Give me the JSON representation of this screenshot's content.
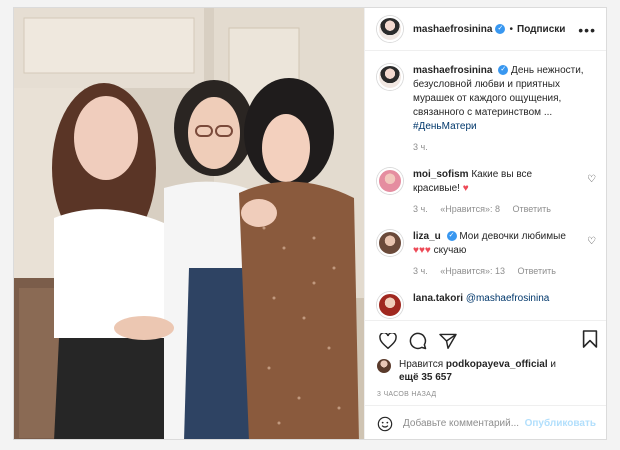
{
  "post": {
    "author": "mashaefrosinina",
    "follow_separator": "•",
    "follow_label": "Подписки",
    "more_icon": "more-horizontal-icon"
  },
  "caption": {
    "author": "mashaefrosinina",
    "text": "День нежности, безусловной любви и приятных мурашек от каждого ощущения, связанного с материнством ...",
    "hashtag": "#ДеньМатери",
    "time": "3 ч."
  },
  "comments": [
    {
      "author": "moi_sofism",
      "text": "Какие вы все красивые!",
      "emoji": "♥",
      "time": "3 ч.",
      "likes": "«Нравится»: 8",
      "reply": "Ответить"
    },
    {
      "author": "liza_u",
      "text": "Мои девочки любимые",
      "emoji": "♥♥♥",
      "text2": "скучаю",
      "time": "3 ч.",
      "likes": "«Нравится»: 13",
      "reply": "Ответить"
    },
    {
      "author": "lana.takori",
      "text": "@mashaefrosinina"
    }
  ],
  "likes": {
    "prefix": "Нравится",
    "user": "podkopayeva_official",
    "suffix": "и",
    "more": "ещё 35 657"
  },
  "timestamp": "3 ЧАСОВ НАЗАД",
  "add_comment": {
    "placeholder": "Добавьте комментарий...",
    "publish": "Опубликовать"
  },
  "colors": {
    "verified": "#3897f0",
    "heart": "#ed4956",
    "publish_disabled": "#b2dffc",
    "hashtag": "#00376b"
  }
}
